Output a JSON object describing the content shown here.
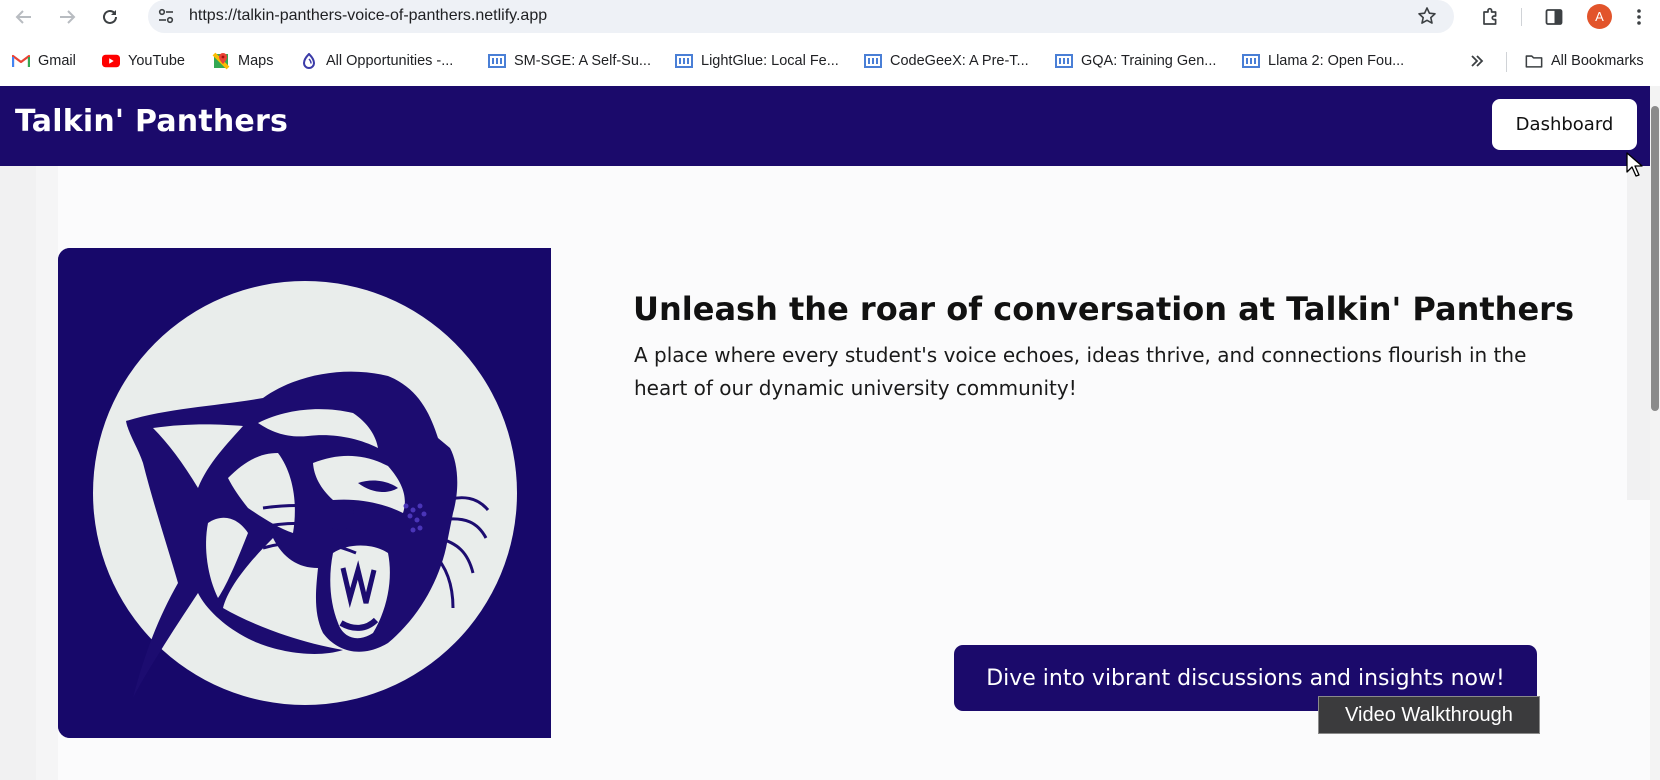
{
  "browser": {
    "url": "https://talkin-panthers-voice-of-panthers.netlify.app",
    "avatar_letter": "A",
    "bookmarks": [
      {
        "label": "Gmail",
        "icon": "gmail-icon"
      },
      {
        "label": "YouTube",
        "icon": "youtube-icon"
      },
      {
        "label": "Maps",
        "icon": "maps-icon"
      },
      {
        "label": "All Opportunities -...",
        "icon": "opportunities-icon"
      },
      {
        "label": "SM-SGE: A Self-Su...",
        "icon": "paper-icon"
      },
      {
        "label": "LightGlue: Local Fe...",
        "icon": "paper-icon"
      },
      {
        "label": "CodeGeeX: A Pre-T...",
        "icon": "paper-icon"
      },
      {
        "label": "GQA: Training Gen...",
        "icon": "paper-icon"
      },
      {
        "label": "Llama 2: Open Fou...",
        "icon": "paper-icon"
      }
    ],
    "all_bookmarks_label": "All Bookmarks"
  },
  "page": {
    "brand": "Talkin' Panthers",
    "dashboard_label": "Dashboard",
    "hero_title": "Unleash the roar of conversation at Talkin' Panthers",
    "hero_subtitle": "A place where every student's voice echoes, ideas thrive, and connections flourish in the heart of our dynamic university community!",
    "cta_label": "Dive into vibrant discussions and insights now!",
    "tooltip": "Video Walkthrough"
  },
  "colors": {
    "brand_navy": "#1b0a6b",
    "logo_circle": "#e9edeb",
    "avatar": "#e2542b"
  }
}
